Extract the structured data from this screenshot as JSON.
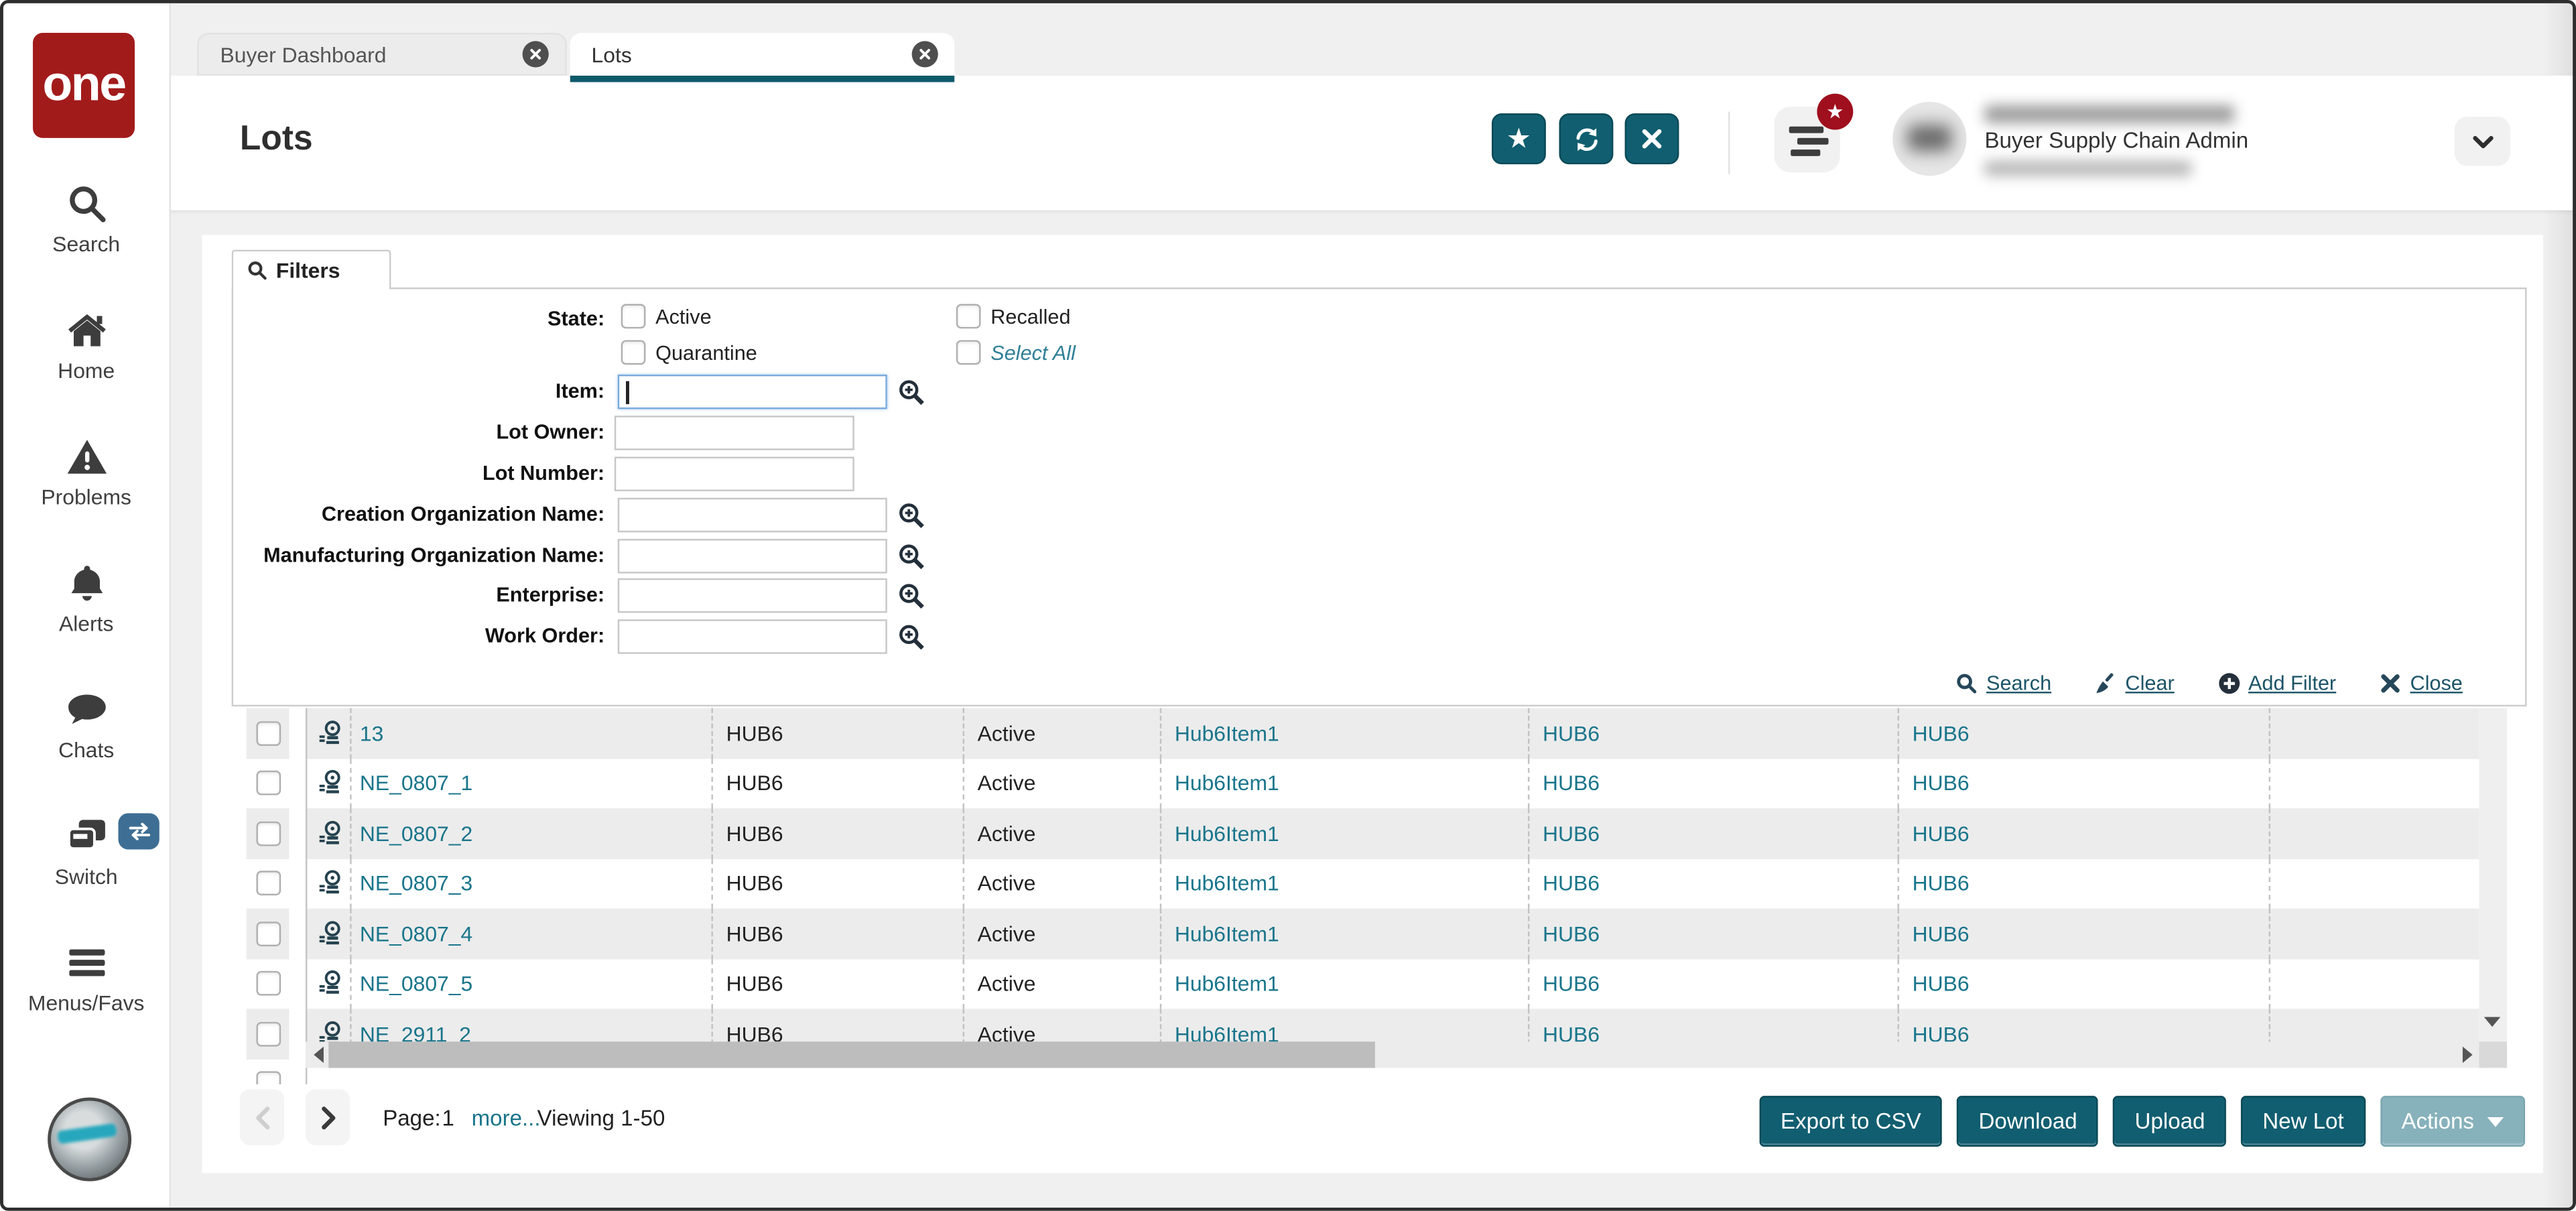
{
  "logo": {
    "text": "one"
  },
  "sidebar": {
    "items": [
      {
        "label": "Search",
        "icon": "search-icon"
      },
      {
        "label": "Home",
        "icon": "home-icon"
      },
      {
        "label": "Problems",
        "icon": "warning-triangle-icon"
      },
      {
        "label": "Alerts",
        "icon": "bell-icon"
      },
      {
        "label": "Chats",
        "icon": "chat-bubble-icon"
      },
      {
        "label": "Switch",
        "icon": "switch-cards-icon",
        "badge_icon": "swap-arrows-icon"
      },
      {
        "label": "Menus/Favs",
        "icon": "hamburger-menu-icon"
      }
    ]
  },
  "tabs": [
    {
      "label": "Buyer Dashboard",
      "active": false
    },
    {
      "label": "Lots",
      "active": true
    }
  ],
  "header": {
    "title": "Lots",
    "action_icons": [
      "favorite-star-icon",
      "refresh-icon",
      "close-icon"
    ],
    "user_role": "Buyer Supply Chain Admin"
  },
  "filters": {
    "tab_label": "Filters",
    "state": {
      "label": "State:",
      "options": [
        "Active",
        "Quarantine",
        "Recalled",
        "Select All"
      ]
    },
    "fields": [
      {
        "label": "Item:",
        "value": "",
        "lookup": true,
        "focused": true
      },
      {
        "label": "Lot Owner:",
        "value": "",
        "lookup": false
      },
      {
        "label": "Lot Number:",
        "value": "",
        "lookup": false
      },
      {
        "label": "Creation Organization Name:",
        "value": "",
        "lookup": true
      },
      {
        "label": "Manufacturing Organization Name:",
        "value": "",
        "lookup": true
      },
      {
        "label": "Enterprise:",
        "value": "",
        "lookup": true
      },
      {
        "label": "Work Order:",
        "value": "",
        "lookup": true
      }
    ],
    "actions": [
      {
        "label": "Search",
        "icon": "search-icon"
      },
      {
        "label": "Clear",
        "icon": "broom-icon"
      },
      {
        "label": "Add Filter",
        "icon": "plus-circle-icon"
      },
      {
        "label": "Close",
        "icon": "x-icon"
      }
    ]
  },
  "table": {
    "rows": [
      {
        "lot": "13",
        "org": "HUB6",
        "state": "Active",
        "item": "Hub6Item1",
        "creation_org": "HUB6",
        "manufacturing_org": "HUB6"
      },
      {
        "lot": "NE_0807_1",
        "org": "HUB6",
        "state": "Active",
        "item": "Hub6Item1",
        "creation_org": "HUB6",
        "manufacturing_org": "HUB6"
      },
      {
        "lot": "NE_0807_2",
        "org": "HUB6",
        "state": "Active",
        "item": "Hub6Item1",
        "creation_org": "HUB6",
        "manufacturing_org": "HUB6"
      },
      {
        "lot": "NE_0807_3",
        "org": "HUB6",
        "state": "Active",
        "item": "Hub6Item1",
        "creation_org": "HUB6",
        "manufacturing_org": "HUB6"
      },
      {
        "lot": "NE_0807_4",
        "org": "HUB6",
        "state": "Active",
        "item": "Hub6Item1",
        "creation_org": "HUB6",
        "manufacturing_org": "HUB6"
      },
      {
        "lot": "NE_0807_5",
        "org": "HUB6",
        "state": "Active",
        "item": "Hub6Item1",
        "creation_org": "HUB6",
        "manufacturing_org": "HUB6"
      },
      {
        "lot": "NE_2911_2",
        "org": "HUB6",
        "state": "Active",
        "item": "Hub6Item1",
        "creation_org": "HUB6",
        "manufacturing_org": "HUB6"
      }
    ]
  },
  "pagination": {
    "page_label": "Page:",
    "page": "1",
    "more": "more...",
    "viewing": "Viewing 1-50"
  },
  "footer": {
    "buttons": [
      "Export to CSV",
      "Download",
      "Upload",
      "New Lot",
      "Actions"
    ]
  },
  "colors": {
    "accent_teal": "#115e70",
    "active_tab_underline": "#0d5a6b",
    "link_teal": "#19758b",
    "logo_red": "#a21b1b",
    "badge_red": "#9f0f1d",
    "disabled_button_teal": "#87b1bb",
    "row_stripe": "#ececec",
    "switch_badge_blue": "#3e6e94"
  }
}
